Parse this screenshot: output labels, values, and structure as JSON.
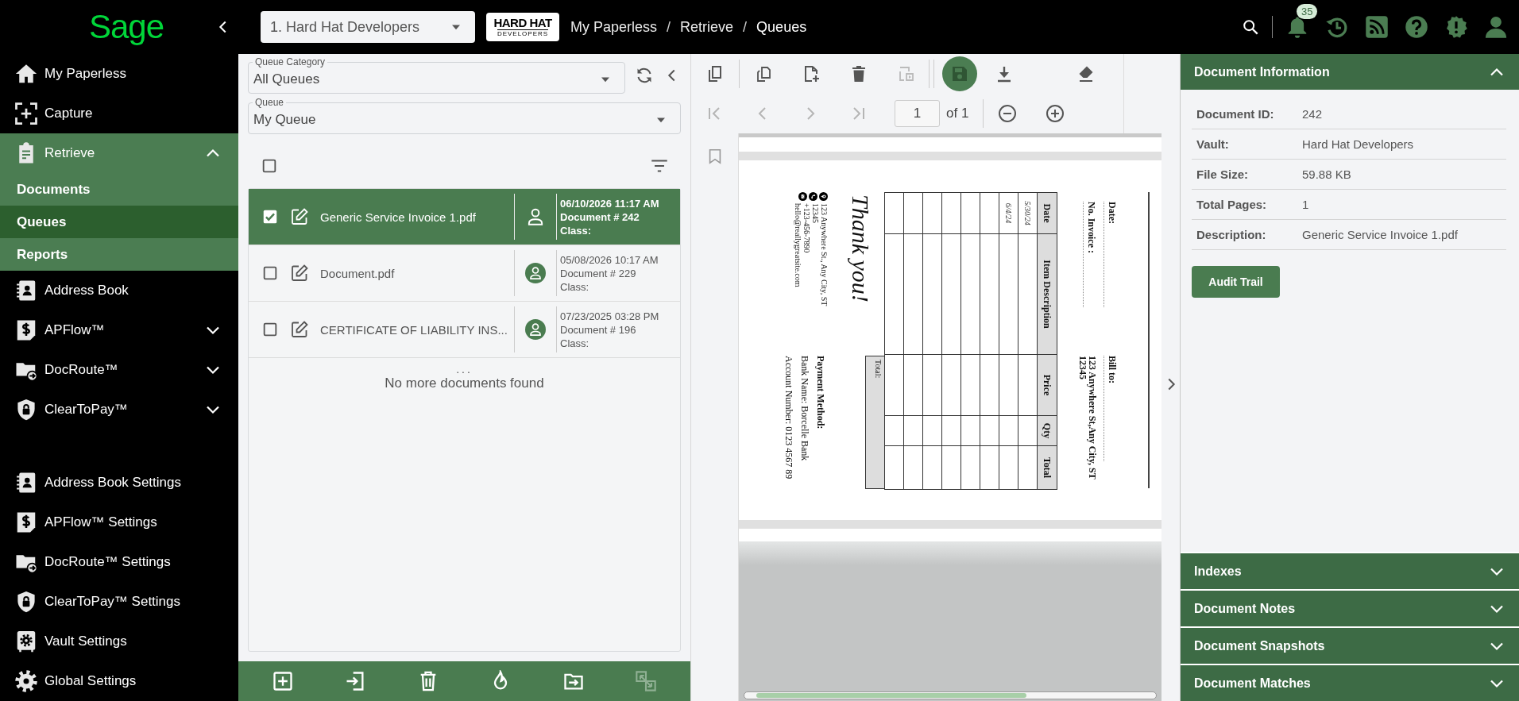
{
  "topbar": {
    "logo": "Sage",
    "vault_select": {
      "value": "1. Hard Hat Developers"
    },
    "company_logo": {
      "name": "HARD HAT",
      "tagline": "DEVELOPERS"
    },
    "breadcrumb": [
      {
        "label": "My Paperless",
        "kind": "link"
      },
      {
        "label": "/",
        "kind": "separator"
      },
      {
        "label": "Retrieve",
        "kind": "link"
      },
      {
        "label": "/",
        "kind": "separator"
      },
      {
        "label": "Queues",
        "kind": "current"
      }
    ],
    "notification_count": "35"
  },
  "sidebar": {
    "items": [
      {
        "label": "My Paperless",
        "kind": "link",
        "selected": false
      },
      {
        "label": "Capture",
        "kind": "link",
        "selected": false
      },
      {
        "label": "Retrieve",
        "kind": "group",
        "selected": true,
        "expanded": true,
        "children": [
          {
            "label": "Documents",
            "selected": false
          },
          {
            "label": "Queues",
            "selected": true
          },
          {
            "label": "Reports",
            "selected": false
          }
        ]
      },
      {
        "label": "Address Book",
        "kind": "link",
        "selected": false
      },
      {
        "label": "APFlow™",
        "kind": "group",
        "selected": false,
        "expanded": false
      },
      {
        "label": "DocRoute™",
        "kind": "group",
        "selected": false,
        "expanded": false
      },
      {
        "label": "ClearToPay™",
        "kind": "group",
        "selected": false,
        "expanded": false
      }
    ],
    "settings_items": [
      {
        "label": "Address Book Settings",
        "selected": false
      },
      {
        "label": "APFlow™ Settings",
        "selected": false
      },
      {
        "label": "DocRoute™ Settings",
        "selected": false
      },
      {
        "label": "ClearToPay™ Settings",
        "selected": false
      },
      {
        "label": "Vault Settings",
        "selected": false
      },
      {
        "label": "Global Settings",
        "selected": false
      }
    ]
  },
  "queue_panel": {
    "category_select": {
      "label": "Queue Category",
      "value": "All Queues"
    },
    "queue_select": {
      "label": "Queue",
      "value": "My Queue"
    },
    "select_all": {
      "checked": false
    },
    "documents": [
      {
        "name": "Generic Service Invoice 1.pdf",
        "checked": true,
        "selected": true,
        "date": "06/10/2026 11:17 AM",
        "number": "Document # 242",
        "class_label": "Class:"
      },
      {
        "name": "Document.pdf",
        "checked": false,
        "selected": false,
        "date": "05/08/2026 10:17 AM",
        "number": "Document # 229",
        "class_label": "Class:"
      },
      {
        "name": "CERTIFICATE OF LIABILITY INS...",
        "checked": false,
        "selected": false,
        "date": "07/23/2025 03:28 PM",
        "number": "Document # 196",
        "class_label": "Class:"
      }
    ],
    "more_indicator": "...",
    "end_message": "No more documents found",
    "actions": [
      {
        "disabled": false
      },
      {
        "disabled": false
      },
      {
        "disabled": false
      },
      {
        "disabled": false
      },
      {
        "disabled": false
      },
      {
        "disabled": true
      }
    ]
  },
  "viewer": {
    "tools": [
      {
        "disabled": false,
        "active": false
      },
      {
        "disabled": false,
        "active": false
      },
      {
        "disabled": false,
        "active": false
      },
      {
        "disabled": false,
        "active": false
      },
      {
        "disabled": true,
        "active": false
      },
      {
        "disabled": false,
        "active": true
      },
      {
        "disabled": false,
        "active": false
      },
      {
        "disabled": false,
        "active": false
      }
    ],
    "nav": [
      {
        "disabled": true
      },
      {
        "disabled": true
      },
      {
        "disabled": true
      },
      {
        "disabled": true
      }
    ],
    "page_field": {
      "value": "1"
    },
    "page_total": "of 1",
    "document": {
      "date_label": "Date:",
      "invoice_label": "No. Invoice :",
      "bill_to_label": "Bill to:",
      "bill_to_address": [
        "123 Anywhere St,Any City, ST",
        "12345"
      ],
      "table": {
        "columns": [
          "Date",
          "Item Description",
          "Price",
          "Qty",
          "Total"
        ],
        "rows": [
          {
            "date": "5/30/24"
          },
          {
            "date": "6/4/24"
          }
        ],
        "total_label": "Total:"
      },
      "thank_you": "Thank you!",
      "contact": [
        "123 Anywhere St., Any City, ST",
        "12345",
        "+123-456-7890",
        "hello@reallygreatsite.com"
      ],
      "payment_heading": "Payment Method:",
      "payment_lines": [
        "Bank Name: Borcelle Bank",
        "Account Number: 0123 4567 89"
      ]
    }
  },
  "info_panel": {
    "sections": [
      {
        "title": "Document Information",
        "expanded": true,
        "fields": [
          {
            "label": "Document ID:",
            "value": "242"
          },
          {
            "label": "Vault:",
            "value": "Hard Hat Developers"
          },
          {
            "label": "File Size:",
            "value": "59.88 KB"
          },
          {
            "label": "Total Pages:",
            "value": "1"
          },
          {
            "label": "Description:",
            "value": "Generic Service Invoice 1.pdf"
          }
        ],
        "button": "Audit Trail"
      },
      {
        "title": "Indexes",
        "expanded": false
      },
      {
        "title": "Document Notes",
        "expanded": false
      },
      {
        "title": "Document Snapshots",
        "expanded": false
      },
      {
        "title": "Document Matches",
        "expanded": false
      }
    ]
  }
}
